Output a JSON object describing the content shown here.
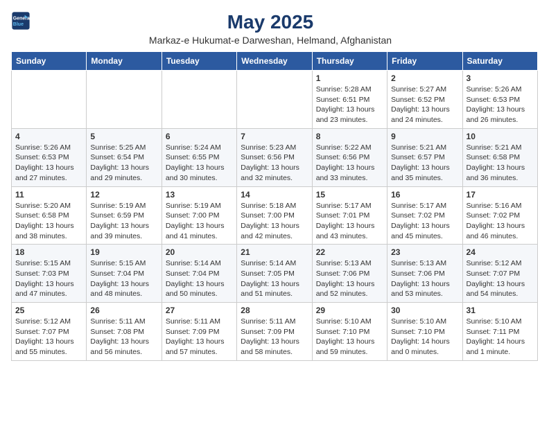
{
  "logo": {
    "line1": "General",
    "line2": "Blue"
  },
  "title": "May 2025",
  "subtitle": "Markaz-e Hukumat-e Darweshan, Helmand, Afghanistan",
  "days_of_week": [
    "Sunday",
    "Monday",
    "Tuesday",
    "Wednesday",
    "Thursday",
    "Friday",
    "Saturday"
  ],
  "weeks": [
    [
      {
        "day": "",
        "info": ""
      },
      {
        "day": "",
        "info": ""
      },
      {
        "day": "",
        "info": ""
      },
      {
        "day": "",
        "info": ""
      },
      {
        "day": "1",
        "info": "Sunrise: 5:28 AM\nSunset: 6:51 PM\nDaylight: 13 hours\nand 23 minutes."
      },
      {
        "day": "2",
        "info": "Sunrise: 5:27 AM\nSunset: 6:52 PM\nDaylight: 13 hours\nand 24 minutes."
      },
      {
        "day": "3",
        "info": "Sunrise: 5:26 AM\nSunset: 6:53 PM\nDaylight: 13 hours\nand 26 minutes."
      }
    ],
    [
      {
        "day": "4",
        "info": "Sunrise: 5:26 AM\nSunset: 6:53 PM\nDaylight: 13 hours\nand 27 minutes."
      },
      {
        "day": "5",
        "info": "Sunrise: 5:25 AM\nSunset: 6:54 PM\nDaylight: 13 hours\nand 29 minutes."
      },
      {
        "day": "6",
        "info": "Sunrise: 5:24 AM\nSunset: 6:55 PM\nDaylight: 13 hours\nand 30 minutes."
      },
      {
        "day": "7",
        "info": "Sunrise: 5:23 AM\nSunset: 6:56 PM\nDaylight: 13 hours\nand 32 minutes."
      },
      {
        "day": "8",
        "info": "Sunrise: 5:22 AM\nSunset: 6:56 PM\nDaylight: 13 hours\nand 33 minutes."
      },
      {
        "day": "9",
        "info": "Sunrise: 5:21 AM\nSunset: 6:57 PM\nDaylight: 13 hours\nand 35 minutes."
      },
      {
        "day": "10",
        "info": "Sunrise: 5:21 AM\nSunset: 6:58 PM\nDaylight: 13 hours\nand 36 minutes."
      }
    ],
    [
      {
        "day": "11",
        "info": "Sunrise: 5:20 AM\nSunset: 6:58 PM\nDaylight: 13 hours\nand 38 minutes."
      },
      {
        "day": "12",
        "info": "Sunrise: 5:19 AM\nSunset: 6:59 PM\nDaylight: 13 hours\nand 39 minutes."
      },
      {
        "day": "13",
        "info": "Sunrise: 5:19 AM\nSunset: 7:00 PM\nDaylight: 13 hours\nand 41 minutes."
      },
      {
        "day": "14",
        "info": "Sunrise: 5:18 AM\nSunset: 7:00 PM\nDaylight: 13 hours\nand 42 minutes."
      },
      {
        "day": "15",
        "info": "Sunrise: 5:17 AM\nSunset: 7:01 PM\nDaylight: 13 hours\nand 43 minutes."
      },
      {
        "day": "16",
        "info": "Sunrise: 5:17 AM\nSunset: 7:02 PM\nDaylight: 13 hours\nand 45 minutes."
      },
      {
        "day": "17",
        "info": "Sunrise: 5:16 AM\nSunset: 7:02 PM\nDaylight: 13 hours\nand 46 minutes."
      }
    ],
    [
      {
        "day": "18",
        "info": "Sunrise: 5:15 AM\nSunset: 7:03 PM\nDaylight: 13 hours\nand 47 minutes."
      },
      {
        "day": "19",
        "info": "Sunrise: 5:15 AM\nSunset: 7:04 PM\nDaylight: 13 hours\nand 48 minutes."
      },
      {
        "day": "20",
        "info": "Sunrise: 5:14 AM\nSunset: 7:04 PM\nDaylight: 13 hours\nand 50 minutes."
      },
      {
        "day": "21",
        "info": "Sunrise: 5:14 AM\nSunset: 7:05 PM\nDaylight: 13 hours\nand 51 minutes."
      },
      {
        "day": "22",
        "info": "Sunrise: 5:13 AM\nSunset: 7:06 PM\nDaylight: 13 hours\nand 52 minutes."
      },
      {
        "day": "23",
        "info": "Sunrise: 5:13 AM\nSunset: 7:06 PM\nDaylight: 13 hours\nand 53 minutes."
      },
      {
        "day": "24",
        "info": "Sunrise: 5:12 AM\nSunset: 7:07 PM\nDaylight: 13 hours\nand 54 minutes."
      }
    ],
    [
      {
        "day": "25",
        "info": "Sunrise: 5:12 AM\nSunset: 7:07 PM\nDaylight: 13 hours\nand 55 minutes."
      },
      {
        "day": "26",
        "info": "Sunrise: 5:11 AM\nSunset: 7:08 PM\nDaylight: 13 hours\nand 56 minutes."
      },
      {
        "day": "27",
        "info": "Sunrise: 5:11 AM\nSunset: 7:09 PM\nDaylight: 13 hours\nand 57 minutes."
      },
      {
        "day": "28",
        "info": "Sunrise: 5:11 AM\nSunset: 7:09 PM\nDaylight: 13 hours\nand 58 minutes."
      },
      {
        "day": "29",
        "info": "Sunrise: 5:10 AM\nSunset: 7:10 PM\nDaylight: 13 hours\nand 59 minutes."
      },
      {
        "day": "30",
        "info": "Sunrise: 5:10 AM\nSunset: 7:10 PM\nDaylight: 14 hours\nand 0 minutes."
      },
      {
        "day": "31",
        "info": "Sunrise: 5:10 AM\nSunset: 7:11 PM\nDaylight: 14 hours\nand 1 minute."
      }
    ]
  ]
}
